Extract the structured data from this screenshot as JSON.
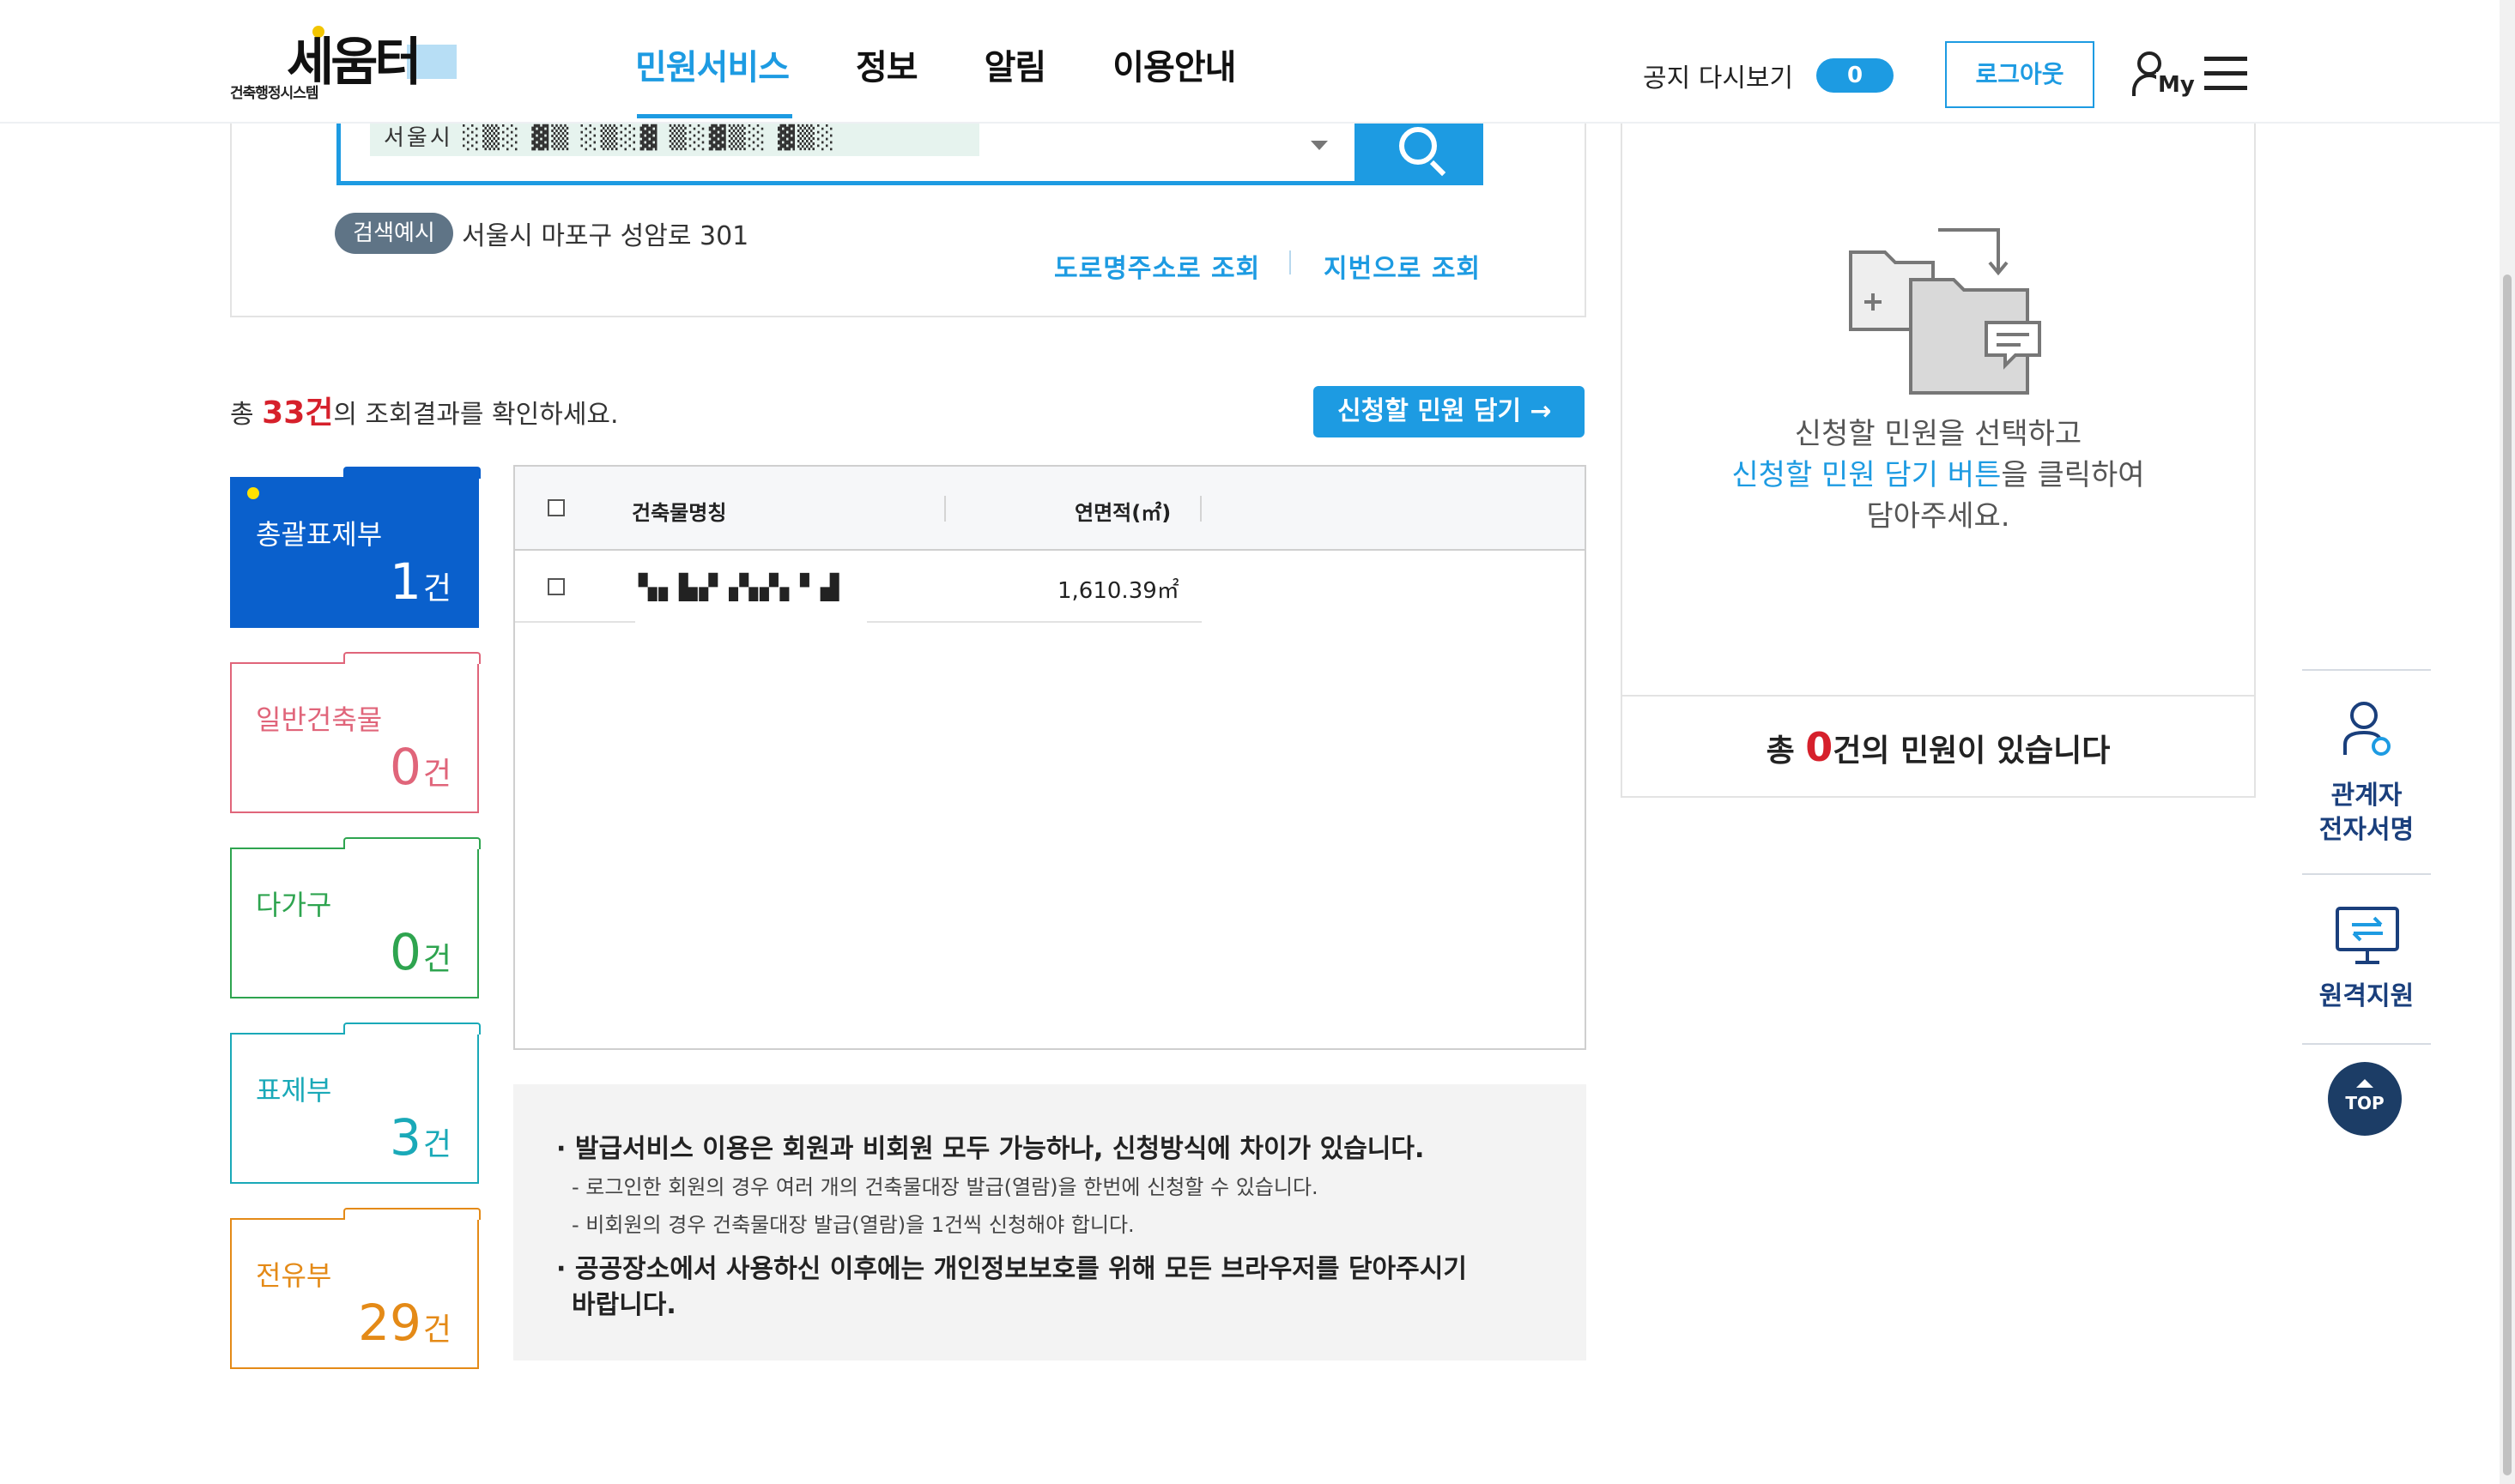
{
  "header": {
    "logo_sub": "건축행정시스템",
    "logo_main": "세움터",
    "nav": [
      "민원서비스",
      "정보",
      "알림",
      "이용안내"
    ],
    "notice_replay": "공지 다시보기",
    "notice_toggle": "0",
    "logout": "로그아웃",
    "my_label": "My"
  },
  "search": {
    "value": "서울시 ░▒░ ▓▒ ░▒░▓ ▒░▓▒░ ▓▒░",
    "example_badge": "검색예시",
    "example_text": "서울시 마포구 성암로 301",
    "road_link": "도로명주소로 조회",
    "jibun_link": "지번으로 조회"
  },
  "results": {
    "prefix": "총 ",
    "count": "33건",
    "suffix": "의 조회결과를 확인하세요.",
    "add_button": "신청할 민원 담기 →"
  },
  "categories": [
    {
      "label": "총괄표제부",
      "count": "1",
      "unit": "건",
      "color": "#0a60cc",
      "active": true
    },
    {
      "label": "일반건축물",
      "count": "0",
      "unit": "건",
      "color": "#e0657a",
      "active": false
    },
    {
      "label": "다가구",
      "count": "0",
      "unit": "건",
      "color": "#2ea44f",
      "active": false
    },
    {
      "label": "표제부",
      "count": "3",
      "unit": "건",
      "color": "#1aa9b8",
      "active": false
    },
    {
      "label": "전유부",
      "count": "29",
      "unit": "건",
      "color": "#e48a17",
      "active": false
    }
  ],
  "table": {
    "headers": [
      "건축물명칭",
      "연면적(㎡)"
    ],
    "rows": [
      {
        "name": "▚▖▙▞▗▚▞▖▘▟",
        "area": "1,610.39㎡"
      }
    ]
  },
  "info": {
    "line1": "· 발급서비스 이용은 회원과 비회원 모두 가능하나, 신청방식에 차이가 있습니다.",
    "line2": "- 로그인한 회원의 경우 여러 개의 건축물대장 발급(열람)을 한번에 신청할 수 있습니다.",
    "line3": "- 비회원의 경우 건축물대장 발급(열람)을 1건씩 신청해야 합니다.",
    "line4": "· 공공장소에서 사용하신 이후에는 개인정보보호를 위해 모든 브라우저를 닫아주시기",
    "line5": "바랍니다."
  },
  "cart": {
    "msg1": "신청할 민원을 선택하고",
    "msg2_hl": "신청할 민원 담기 버튼",
    "msg2_rest": "을 클릭하여",
    "msg3": "담아주세요.",
    "footer_prefix": "총 ",
    "footer_count": "0",
    "footer_suffix": "건의 민원이 있습니다"
  },
  "quick": {
    "sign_line1": "관계자",
    "sign_line2": "전자서명",
    "remote": "원격지원",
    "top": "TOP"
  },
  "colors": {
    "accent": "#1d9be2",
    "primary_dark": "#0a60cc",
    "alert": "#d6202b"
  }
}
